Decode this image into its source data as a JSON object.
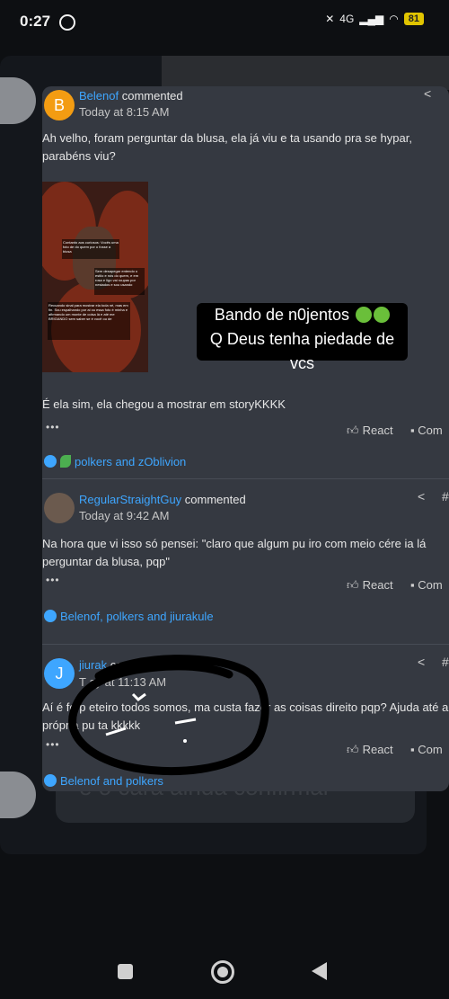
{
  "status_bar": {
    "time": "0:27",
    "network": "4G",
    "battery": "81"
  },
  "background": {
    "faded_text": "e o cara ainda confirmar"
  },
  "overlay": {
    "line1": "Bando de n0jentos",
    "line2": "Q Deus tenha piedade de vcs"
  },
  "comments": [
    {
      "avatar_letter": "B",
      "user": "Belenof",
      "action": "commented",
      "time": "Today at 8:15 AM",
      "text": "Ah velho, foram perguntar da blusa, ela já viu e ta usando pra se hypar, parabéns viu?",
      "text2": "É ela sim, ela chegou a mostrar em storyKKKK",
      "dots": "•••",
      "react": "React",
      "comment": "Com",
      "likes": "polkers and zOblivion"
    },
    {
      "avatar_letter": "",
      "user": "RegularStraightGuy",
      "action": "commented",
      "time": "Today at 9:42 AM",
      "text": "Na hora que vi isso só pensei: \"claro que algum pu      iro com meio cére ia lá perguntar da blusa, pqp\"",
      "dots": "•••",
      "react": "React",
      "comment": "Com",
      "likes": "Belenof, polkers and jiurakule"
    },
    {
      "avatar_letter": "J",
      "user": "jiurak",
      "action": "commented",
      "time": "T   ay at 11:13 AM",
      "text": "Aí é fo    p   eteiro todos somos, ma  custa fazer as coisas direito pqp? Ajuda    até a própria pu     ta kkkkk",
      "dots": "•••",
      "react": "React",
      "comment": "Com",
      "likes": "Belenof and polkers"
    }
  ],
  "photo_text": {
    "box1": "Contanto aos curiosos: Vocês uma foto de do quem por o fosse a blusa",
    "box2": "Sem desapegar entendo o estilo e nós do quem, e em rosa e ligo vai roupas por nestados e sou usando",
    "box3": "Recuando sinal para mostrar ela toda né, mas em fin. Sou espalhando por ai ou essa foto é minha e afirmando um monte de coisa lá e até me BRIGANDO sem saber se é você ou de"
  }
}
